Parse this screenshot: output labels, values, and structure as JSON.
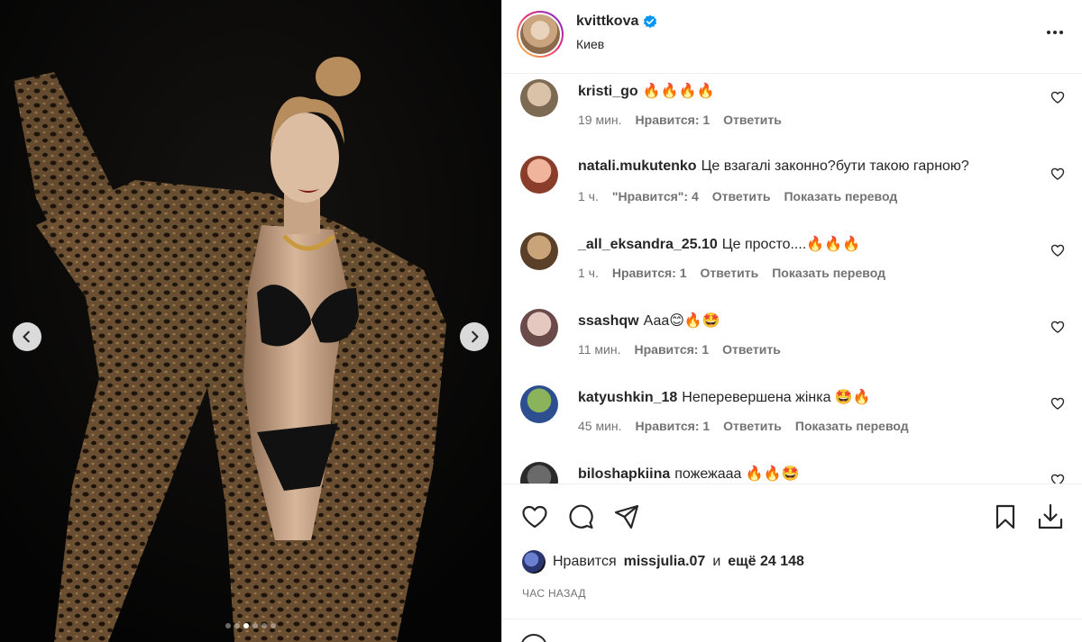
{
  "post": {
    "username": "kvittkova",
    "location": "Киев",
    "verified_color": "#0095f6"
  },
  "carousel": {
    "slide_count": 6,
    "active_index": 2
  },
  "comments": [
    {
      "user": "kristi_go",
      "text": "🔥🔥🔥🔥",
      "time": "19 мин.",
      "likes": "Нравится: 1",
      "reply": "Ответить",
      "translate": ""
    },
    {
      "user": "natali.mukutenko",
      "text": "Це взагалі законно?бути такою гарною?",
      "time": "1 ч.",
      "likes": "\"Нравится\": 4",
      "reply": "Ответить",
      "translate": "Показать перевод"
    },
    {
      "user": "_all_eksandra_25.10",
      "text": "Це просто....🔥🔥🔥",
      "time": "1 ч.",
      "likes": "Нравится: 1",
      "reply": "Ответить",
      "translate": "Показать перевод"
    },
    {
      "user": "ssashqw",
      "text": "Ааа😊🔥🤩",
      "time": "11 мин.",
      "likes": "Нравится: 1",
      "reply": "Ответить",
      "translate": ""
    },
    {
      "user": "katyushkin_18",
      "text": "Неперевершена жінка 🤩🔥",
      "time": "45 мин.",
      "likes": "Нравится: 1",
      "reply": "Ответить",
      "translate": "Показать перевод"
    },
    {
      "user": "biloshapkiina",
      "text": "пожежааа 🔥🔥🤩",
      "time": "",
      "likes": "",
      "reply": "",
      "translate": ""
    }
  ],
  "likes_line": {
    "prefix": "Нравится",
    "user": "missjulia.07",
    "middle": "и",
    "count": "ещё 24 148"
  },
  "time_ago": "ЧАС НАЗАД"
}
